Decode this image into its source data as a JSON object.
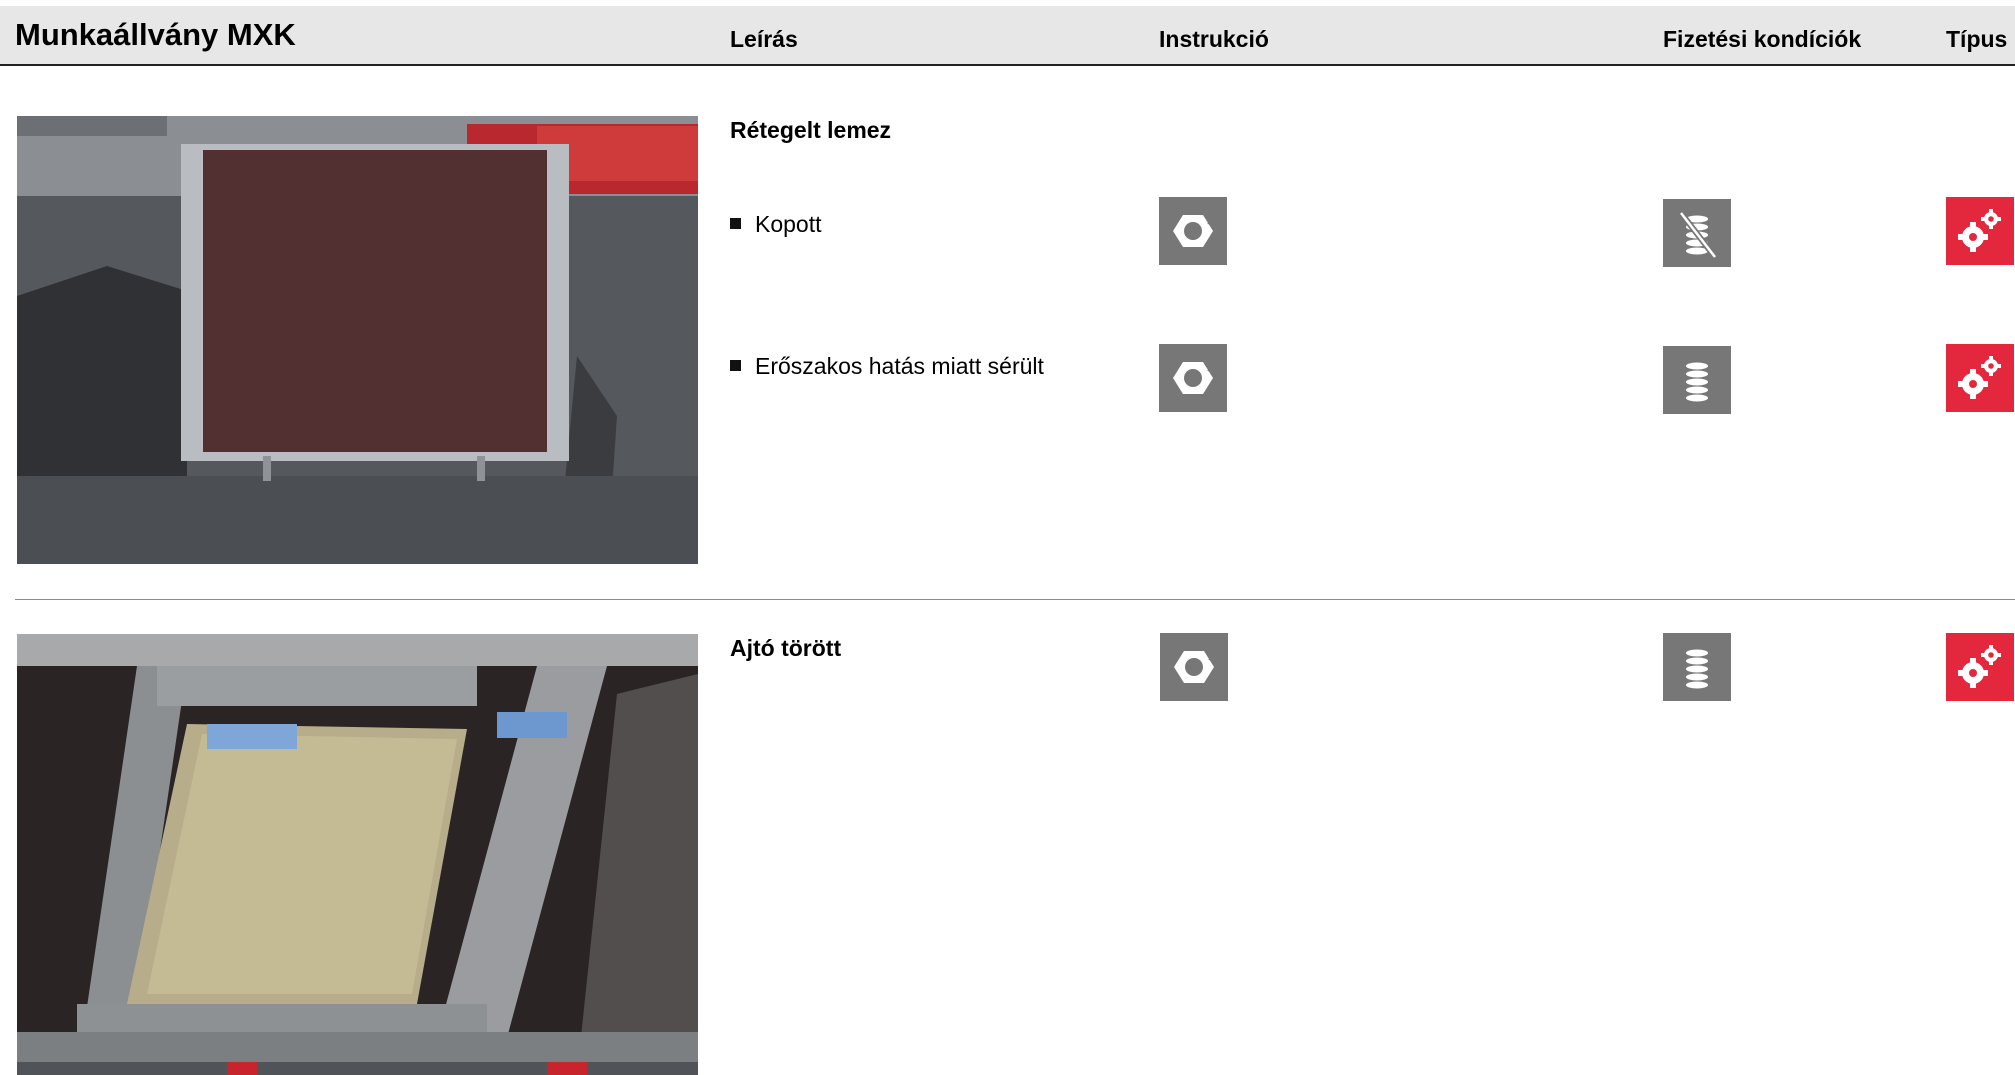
{
  "header": {
    "title": "Munkaállvány MXK",
    "col_description": "Leírás",
    "col_instruction": "Instrukció",
    "col_payment": "Fizetési kondíciók",
    "col_type": "Típus"
  },
  "sections": [
    {
      "title": "Rétegelt lemez",
      "items": [
        {
          "label": "Kopott",
          "instruction_icon": "hex-nut-icon",
          "payment_icon": "coins-crossed-icon",
          "type_icon": "gears-icon"
        },
        {
          "label": "Erőszakos hatás miatt sérült",
          "instruction_icon": "hex-nut-icon",
          "payment_icon": "coins-icon",
          "type_icon": "gears-icon"
        }
      ]
    },
    {
      "title": "Ajtó törött",
      "instruction_icon": "hex-nut-icon",
      "payment_icon": "coins-icon",
      "type_icon": "gears-icon"
    }
  ],
  "colors": {
    "header_bg": "#e7e7e7",
    "icon_grey": "#777777",
    "icon_red": "#e3273d"
  }
}
